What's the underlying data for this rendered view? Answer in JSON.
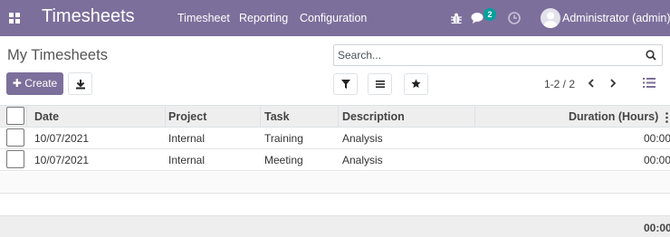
{
  "navbar": {
    "app_title": "Timesheets",
    "menu": [
      "Timesheet",
      "Reporting",
      "Configuration"
    ],
    "messages_badge": "2",
    "user_name": "Administrator (admin)",
    "background": "#7c6f9b",
    "badge_color": "#00a09d"
  },
  "control_panel": {
    "page_title": "My Timesheets",
    "search_placeholder": "Search...",
    "create_label": "Create",
    "pager": "1-2 / 2",
    "icons": [
      "download-icon",
      "filter-icon",
      "group-by-icon",
      "favorite-star-icon",
      "pager-prev-icon",
      "pager-next-icon",
      "list-view-icon"
    ]
  },
  "table": {
    "columns": [
      "Date",
      "Project",
      "Task",
      "Description",
      "Duration (Hours)"
    ],
    "rows": [
      {
        "date": "10/07/2021",
        "project": "Internal",
        "task": "Training",
        "description": "Analysis",
        "duration": "00:00"
      },
      {
        "date": "10/07/2021",
        "project": "Internal",
        "task": "Meeting",
        "description": "Analysis",
        "duration": "00:00"
      }
    ],
    "total_duration": "00:00"
  }
}
